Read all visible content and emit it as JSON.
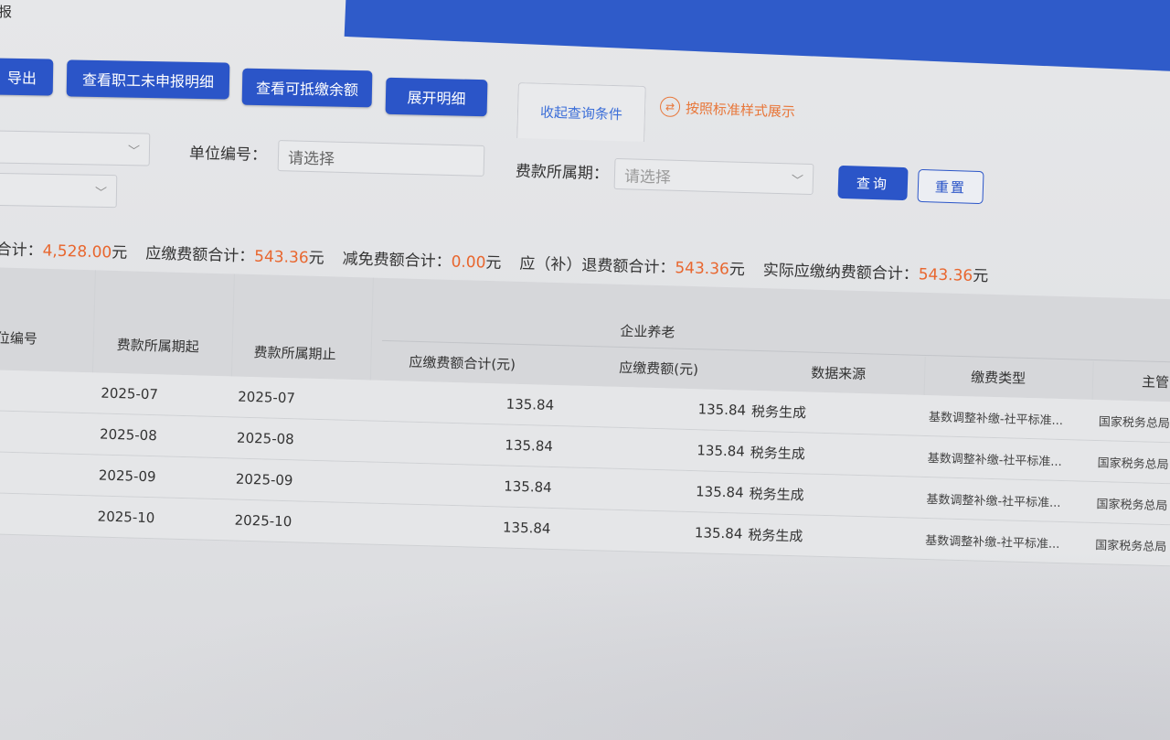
{
  "page": {
    "label": "报"
  },
  "toolbar": {
    "export_label": "导出",
    "unreported_label": "查看职工未申报明细",
    "deductible_label": "查看可抵缴余额",
    "expand_label": "展开明细",
    "collapse_tab_label": "收起查询条件",
    "standard_style_label": "按照标准样式展示"
  },
  "filters": {
    "unit_no_label": "单位编号：",
    "unit_no_placeholder": "请选择",
    "period_label": "费款所属期：",
    "period_placeholder": "请选择",
    "query_label": "查询",
    "reset_label": "重置"
  },
  "summary": {
    "items": [
      {
        "label": "合计：",
        "value": "4,528.00",
        "unit": "元"
      },
      {
        "label": "应缴费额合计：",
        "value": "543.36",
        "unit": "元"
      },
      {
        "label": "减免费额合计：",
        "value": "0.00",
        "unit": "元"
      },
      {
        "label": "应（补）退费额合计：",
        "value": "543.36",
        "unit": "元"
      },
      {
        "label": "实际应缴纳费额合计：",
        "value": "543.36",
        "unit": "元"
      }
    ]
  },
  "table": {
    "group_header": "企业养老",
    "headers": {
      "unit_no": "位编号",
      "period_start": "费款所属期起",
      "period_end": "费款所属期止",
      "due_total": "应缴费额合计(元)",
      "due_amount": "应缴费额(元)",
      "data_source": "数据来源",
      "pay_type": "缴费类型",
      "authority": "主管"
    },
    "rows": [
      {
        "period_start": "2025-07",
        "period_end": "2025-07",
        "due_total": "135.84",
        "due_amount": "135.84",
        "data_source": "税务生成",
        "pay_type": "基数调整补缴-社平标准...",
        "authority": "国家税务总局"
      },
      {
        "period_start": "2025-08",
        "period_end": "2025-08",
        "due_total": "135.84",
        "due_amount": "135.84",
        "data_source": "税务生成",
        "pay_type": "基数调整补缴-社平标准...",
        "authority": "国家税务总局"
      },
      {
        "period_start": "2025-09",
        "period_end": "2025-09",
        "due_total": "135.84",
        "due_amount": "135.84",
        "data_source": "税务生成",
        "pay_type": "基数调整补缴-社平标准...",
        "authority": "国家税务总局"
      },
      {
        "period_start": "2025-10",
        "period_end": "2025-10",
        "due_total": "135.84",
        "due_amount": "135.84",
        "data_source": "税务生成",
        "pay_type": "基数调整补缴-社平标准...",
        "authority": "国家税务总局"
      }
    ]
  },
  "colors": {
    "primary": "#2b55c8",
    "accent_orange": "#e8662e",
    "tab_text": "#3d6fd8"
  },
  "icons": {
    "swap": "swap-icon",
    "chevron": "chevron-down-icon"
  }
}
